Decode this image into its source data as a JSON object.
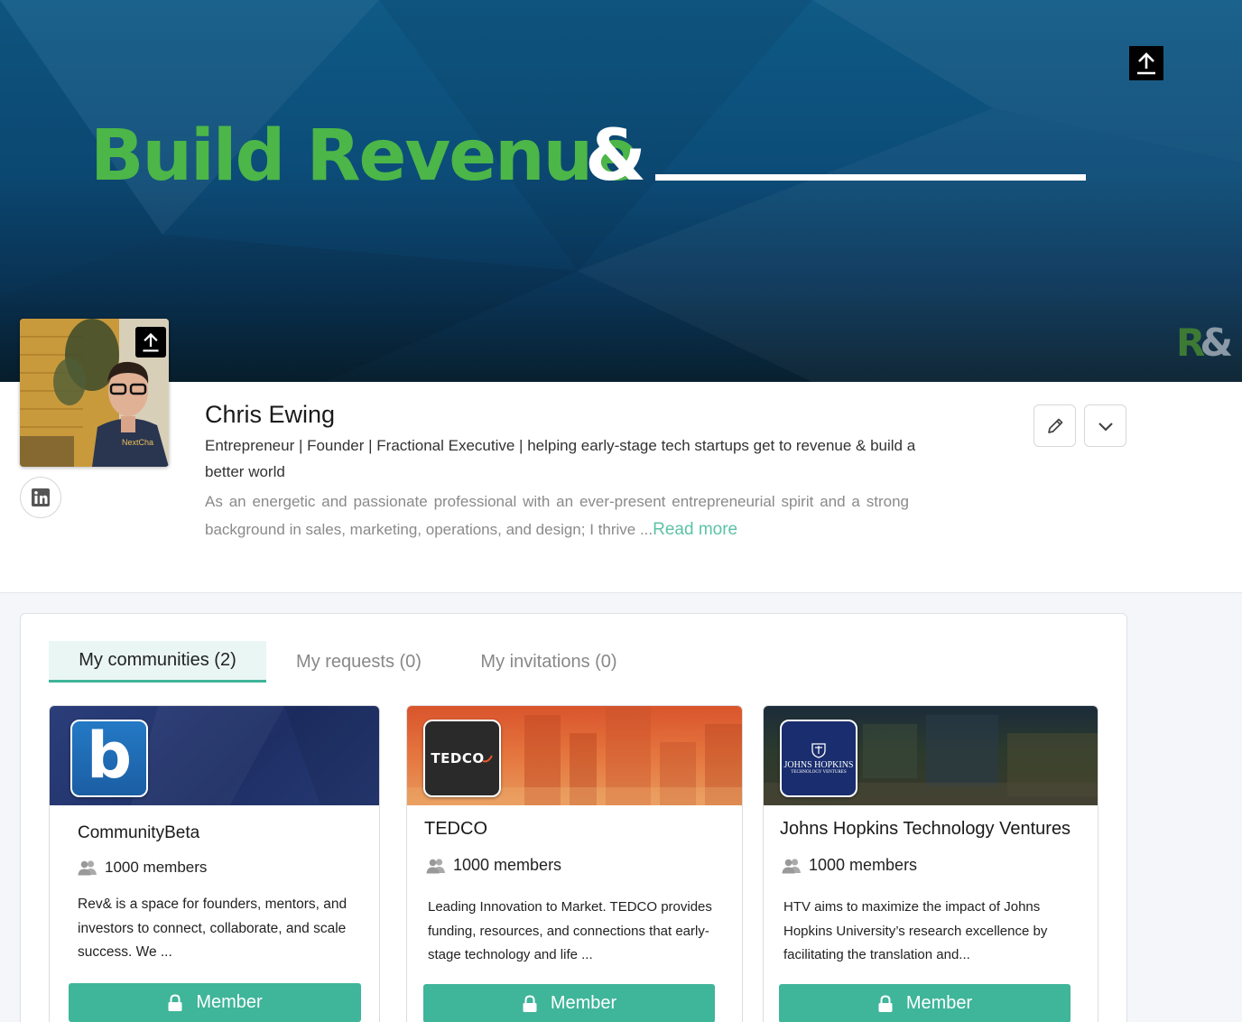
{
  "banner": {
    "title_green": "Build Revenue",
    "title_amp": "&",
    "logo_r": "R",
    "logo_amp": "&"
  },
  "profile": {
    "name": "Chris Ewing",
    "headline": "Entrepreneur | Founder | Fractional Executive | helping early-stage tech startups get to revenue & build a better world",
    "bio": "As an energetic and passionate professional with an ever-present entrepreneurial spirit and a strong background in sales, marketing, operations, and design; I thrive ...",
    "read_more": "Read more",
    "avatar_shirt_text": "NextCha"
  },
  "tabs": [
    {
      "label": "My communities (2)",
      "active": true
    },
    {
      "label": "My requests (0)",
      "active": false
    },
    {
      "label": "My invitations (0)",
      "active": false
    }
  ],
  "communities": [
    {
      "name": "CommunityBeta",
      "members": "1000 members",
      "description": "Rev& is a space for founders, mentors, and investors to connect, collaborate, and scale success. We ...",
      "button": "Member",
      "logo_text": "b"
    },
    {
      "name": "TEDCO",
      "members": "1000 members",
      "description": "Leading Innovation to Market. TEDCO provides funding, resources, and connections that early-stage technology and life ...",
      "button": "Member",
      "logo_text": "TEDCO"
    },
    {
      "name": "Johns Hopkins Technology Ventures",
      "members": "1000 members",
      "description": "HTV aims to maximize the impact of Johns Hopkins University’s research excellence by facilitating the translation and...",
      "button": "Member",
      "logo_text": "JOHNS HOPKINS",
      "logo_subtext": "TECHNOLOGY VENTURES"
    }
  ],
  "colors": {
    "accent": "#3fb59a",
    "banner_green": "#4cb648",
    "link": "#5cc2a6"
  }
}
